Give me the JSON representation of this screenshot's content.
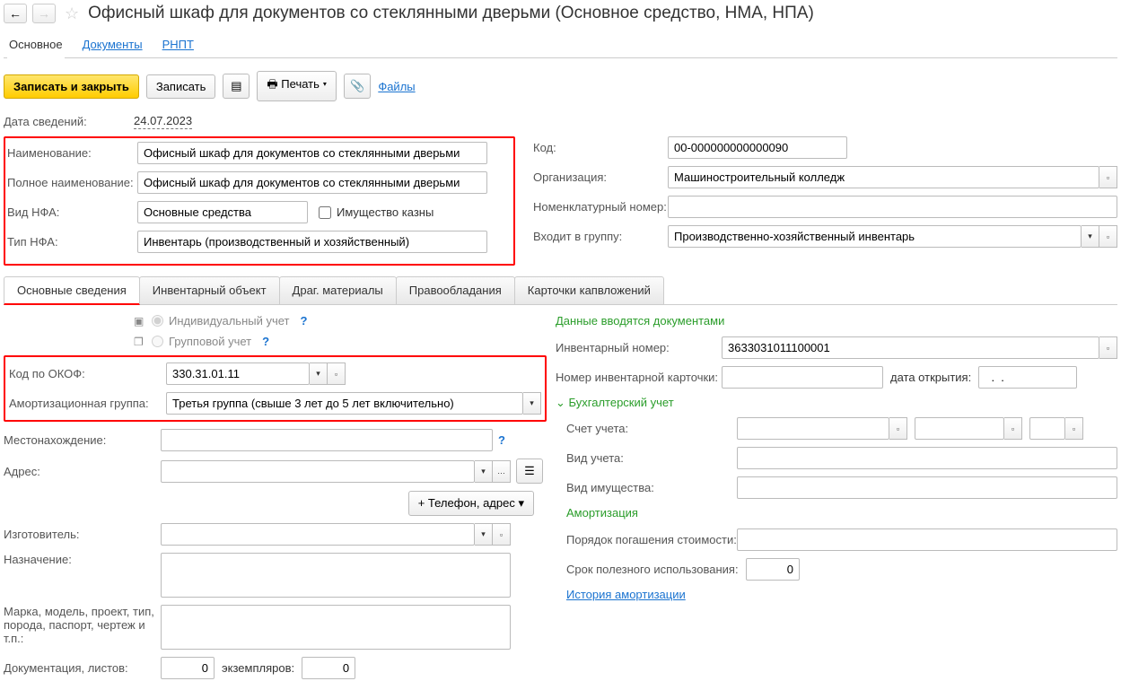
{
  "title": "Офисный шкаф для документов со стеклянными дверьми (Основное средство, НМА, НПА)",
  "navTabs": {
    "main": "Основное",
    "docs": "Документы",
    "rnpt": "РНПТ"
  },
  "toolbar": {
    "saveClose": "Записать и закрыть",
    "save": "Записать",
    "print": "Печать",
    "files": "Файлы"
  },
  "dateLabel": "Дата сведений:",
  "dateValue": "24.07.2023",
  "labels": {
    "name": "Наименование:",
    "fullName": "Полное наименование:",
    "vidNFA": "Вид НФА:",
    "tipNFA": "Тип НФА:",
    "code": "Код:",
    "org": "Организация:",
    "nomNum": "Номенклатурный номер:",
    "group": "Входит в группу:",
    "propTreasury": "Имущество казны",
    "okof": "Код по ОКОФ:",
    "amortGroup": "Амортизационная группа:",
    "location": "Местонахождение:",
    "address": "Адрес:",
    "phoneAddr": "+ Телефон, адрес",
    "manufacturer": "Изготовитель:",
    "purpose": "Назначение:",
    "model": "Марка, модель, проект, тип, порода, паспорт, чертеж и т.п.:",
    "docs": "Документация, листов:",
    "copies": "экземпляров:",
    "invNum": "Инвентарный номер:",
    "invCard": "Номер инвентарной карточки:",
    "openDate": "дата открытия:",
    "acct": "Счет учета:",
    "acctType": "Вид учета:",
    "propType": "Вид имущества:",
    "amortOrder": "Порядок погашения стоимости:",
    "useful": "Срок полезного использования:"
  },
  "values": {
    "name": "Офисный шкаф для документов со стеклянными дверьми",
    "fullName": "Офисный шкаф для документов со стеклянными дверьми",
    "vidNFA": "Основные средства",
    "tipNFA": "Инвентарь (производственный и хозяйственный)",
    "code": "00-000000000000090",
    "org": "Машиностроительный колледж",
    "group": "Производственно-хозяйственный инвентарь",
    "okof": "330.31.01.11",
    "amortGroup": "Третья группа (свыше 3 лет до 5 лет включительно)",
    "invNum": "3633031011100001",
    "docsNum": "0",
    "copiesNum": "0",
    "usefulNum": "0"
  },
  "subTabs": {
    "t1": "Основные сведения",
    "t2": "Инвентарный объект",
    "t3": "Драг. материалы",
    "t4": "Правообладания",
    "t5": "Карточки капвложений"
  },
  "radio": {
    "ind": "Индивидуальный учет",
    "grp": "Групповой учет"
  },
  "headers": {
    "docData": "Данные вводятся документами",
    "buh": "Бухгалтерский учет",
    "amort": "Амортизация",
    "history": "История амортизации"
  }
}
